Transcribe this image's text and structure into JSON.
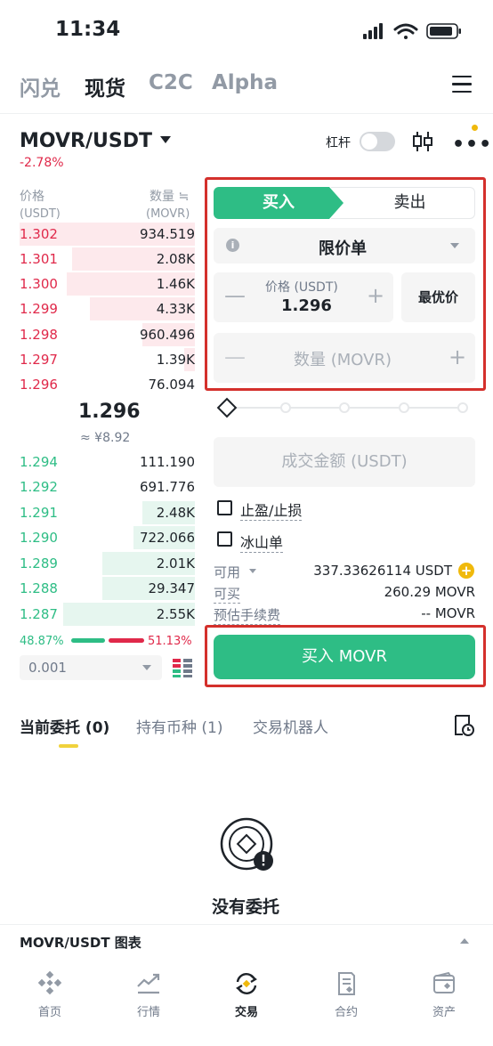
{
  "status_bar": {
    "time": "11:34"
  },
  "top_tabs": [
    "闪兑",
    "现货",
    "C2C",
    "Alpha"
  ],
  "pair": {
    "name": "MOVR/USDT",
    "change": "-2.78%",
    "leverage_label": "杠杆"
  },
  "orderbook": {
    "price_header": "价格",
    "price_unit": "(USDT)",
    "qty_header": "数量 ≒",
    "qty_unit": "(MOVR)",
    "asks": [
      {
        "price": "1.302",
        "qty": "934.519",
        "depth": 1.0
      },
      {
        "price": "1.301",
        "qty": "2.08K",
        "depth": 0.7
      },
      {
        "price": "1.300",
        "qty": "1.46K",
        "depth": 0.73
      },
      {
        "price": "1.299",
        "qty": "4.33K",
        "depth": 0.6
      },
      {
        "price": "1.298",
        "qty": "960.496",
        "depth": 0.3
      },
      {
        "price": "1.297",
        "qty": "1.39K",
        "depth": 0.06
      },
      {
        "price": "1.296",
        "qty": "76.094",
        "depth": 0.0
      }
    ],
    "last_price": "1.296",
    "last_price_fiat": "≈ ¥8.92",
    "bids": [
      {
        "price": "1.294",
        "qty": "111.190",
        "depth": 0.0
      },
      {
        "price": "1.292",
        "qty": "691.776",
        "depth": 0.0
      },
      {
        "price": "1.291",
        "qty": "2.48K",
        "depth": 0.3
      },
      {
        "price": "1.290",
        "qty": "722.066",
        "depth": 0.35
      },
      {
        "price": "1.289",
        "qty": "2.01K",
        "depth": 0.53
      },
      {
        "price": "1.288",
        "qty": "29.347",
        "depth": 0.53
      },
      {
        "price": "1.287",
        "qty": "2.55K",
        "depth": 0.75
      }
    ],
    "buy_ratio": "48.87%",
    "sell_ratio": "51.13%",
    "precision": "0.001"
  },
  "form": {
    "buy_tab": "买入",
    "sell_tab": "卖出",
    "order_type": "限价单",
    "info_glyph": "i",
    "price_label": "价格 (USDT)",
    "price_value": "1.296",
    "best_price": "最优价",
    "qty_placeholder": "数量 (MOVR)",
    "total_placeholder": "成交金额 (USDT)",
    "tp_sl": "止盈/止损",
    "iceberg": "冰山单",
    "available_label": "可用",
    "available_value": "337.33626114 USDT",
    "can_buy_label": "可买",
    "can_buy_value": "260.29 MOVR",
    "fee_label": "预估手续费",
    "fee_value": "-- MOVR",
    "buy_button": "买入 MOVR",
    "minus": "—",
    "plus": "+"
  },
  "orders": {
    "tabs": [
      "当前委托 (0)",
      "持有币种 (1)",
      "交易机器人"
    ],
    "empty_text": "没有委托"
  },
  "chart_bar": {
    "label": "MOVR/USDT 图表"
  },
  "bottom_nav": [
    {
      "label": "首页",
      "icon": "home-icon"
    },
    {
      "label": "行情",
      "icon": "market-icon"
    },
    {
      "label": "交易",
      "icon": "trade-icon"
    },
    {
      "label": "合约",
      "icon": "futures-icon"
    },
    {
      "label": "资产",
      "icon": "wallet-icon"
    }
  ],
  "colors": {
    "green": "#2ebd85",
    "red": "#e0294a",
    "accent": "#f0b90b"
  }
}
